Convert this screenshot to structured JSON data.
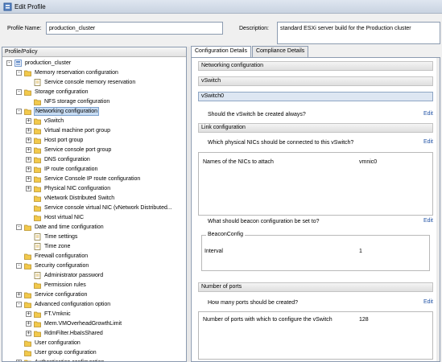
{
  "window": {
    "title": "Edit Profile"
  },
  "header": {
    "profile_name_label": "Profile Name:",
    "profile_name_value": "production_cluster",
    "description_label": "Description:",
    "description_value": "standard ESXi server build for the Production cluster"
  },
  "left_pane": {
    "header": "Profile/Policy",
    "tree": [
      {
        "label": "production_cluster",
        "level": 0,
        "expander": "minus",
        "icon": "profile"
      },
      {
        "label": "Memory reservation configuration",
        "level": 1,
        "expander": "minus",
        "icon": "folder"
      },
      {
        "label": "Service console memory reservation",
        "level": 2,
        "expander": "none",
        "icon": "policy"
      },
      {
        "label": "Storage configuration",
        "level": 1,
        "expander": "minus",
        "icon": "folder"
      },
      {
        "label": "NFS storage configuration",
        "level": 2,
        "expander": "none",
        "icon": "folder"
      },
      {
        "label": "Networking configuration",
        "level": 1,
        "expander": "minus",
        "icon": "folder",
        "selected": true
      },
      {
        "label": "vSwitch",
        "level": 2,
        "expander": "plus",
        "icon": "folder"
      },
      {
        "label": "Virtual machine port group",
        "level": 2,
        "expander": "plus",
        "icon": "folder"
      },
      {
        "label": "Host port group",
        "level": 2,
        "expander": "plus",
        "icon": "folder"
      },
      {
        "label": "Service console port group",
        "level": 2,
        "expander": "plus",
        "icon": "folder"
      },
      {
        "label": "DNS configuration",
        "level": 2,
        "expander": "plus",
        "icon": "folder"
      },
      {
        "label": "IP route configuration",
        "level": 2,
        "expander": "plus",
        "icon": "folder"
      },
      {
        "label": "Service Console IP route configuration",
        "level": 2,
        "expander": "plus",
        "icon": "folder"
      },
      {
        "label": "Physical NIC configuration",
        "level": 2,
        "expander": "plus",
        "icon": "folder"
      },
      {
        "label": "vNetwork Distributed Switch",
        "level": 2,
        "expander": "none",
        "icon": "folder"
      },
      {
        "label": "Service console virtual NIC (vNetwork Distributed...",
        "level": 2,
        "expander": "none",
        "icon": "folder"
      },
      {
        "label": "Host virtual NIC",
        "level": 2,
        "expander": "none",
        "icon": "folder"
      },
      {
        "label": "Date and time configuration",
        "level": 1,
        "expander": "minus",
        "icon": "folder"
      },
      {
        "label": "Time settings",
        "level": 2,
        "expander": "none",
        "icon": "policy"
      },
      {
        "label": "Time zone",
        "level": 2,
        "expander": "none",
        "icon": "policy"
      },
      {
        "label": "Firewall configuration",
        "level": 1,
        "expander": "none",
        "icon": "folder"
      },
      {
        "label": "Security configuration",
        "level": 1,
        "expander": "minus",
        "icon": "folder"
      },
      {
        "label": "Administrator password",
        "level": 2,
        "expander": "none",
        "icon": "policy"
      },
      {
        "label": "Permission rules",
        "level": 2,
        "expander": "none",
        "icon": "folder"
      },
      {
        "label": "Service configuration",
        "level": 1,
        "expander": "plus",
        "icon": "folder"
      },
      {
        "label": "Advanced configuration option",
        "level": 1,
        "expander": "minus",
        "icon": "folder"
      },
      {
        "label": "FT.Vmknic",
        "level": 2,
        "expander": "plus",
        "icon": "folder"
      },
      {
        "label": "Mem.VMOverheadGrowthLimit",
        "level": 2,
        "expander": "plus",
        "icon": "folder"
      },
      {
        "label": "RdmFilter.HbaIsShared",
        "level": 2,
        "expander": "plus",
        "icon": "folder"
      },
      {
        "label": "User configuration",
        "level": 1,
        "expander": "none",
        "icon": "folder"
      },
      {
        "label": "User group configuration",
        "level": 1,
        "expander": "none",
        "icon": "folder"
      },
      {
        "label": "Authentication configuration",
        "level": 1,
        "expander": "plus",
        "icon": "folder"
      }
    ]
  },
  "tabs": [
    {
      "label": "Configuration Details",
      "active": true
    },
    {
      "label": "Compliance Details",
      "active": false
    }
  ],
  "details": {
    "sec_networking": "Networking configuration",
    "sec_vswitch": "vSwitch",
    "sec_vswitch0": "vSwitch0",
    "q_created_always": "Should the vSwitch be created always?",
    "edit_label": "Edit",
    "sec_link": "Link configuration",
    "q_physical_nics": "Which physical NICs should be connected to this vSwitch?",
    "nics_key": "Names of the NICs to attach",
    "nics_value": "vmnic0",
    "q_beacon": "What should beacon configuration be set to?",
    "beacon_group": "BeaconConfig",
    "interval_key": "Interval",
    "interval_value": "1",
    "sec_ports": "Number of ports",
    "q_ports": "How many ports should be created?",
    "ports_key": "Number of ports with which to configure the vSwitch",
    "ports_value": "128"
  },
  "colors": {
    "selection": "#c7dcf3",
    "link": "#2354a6",
    "folder": "#f2c94c"
  }
}
